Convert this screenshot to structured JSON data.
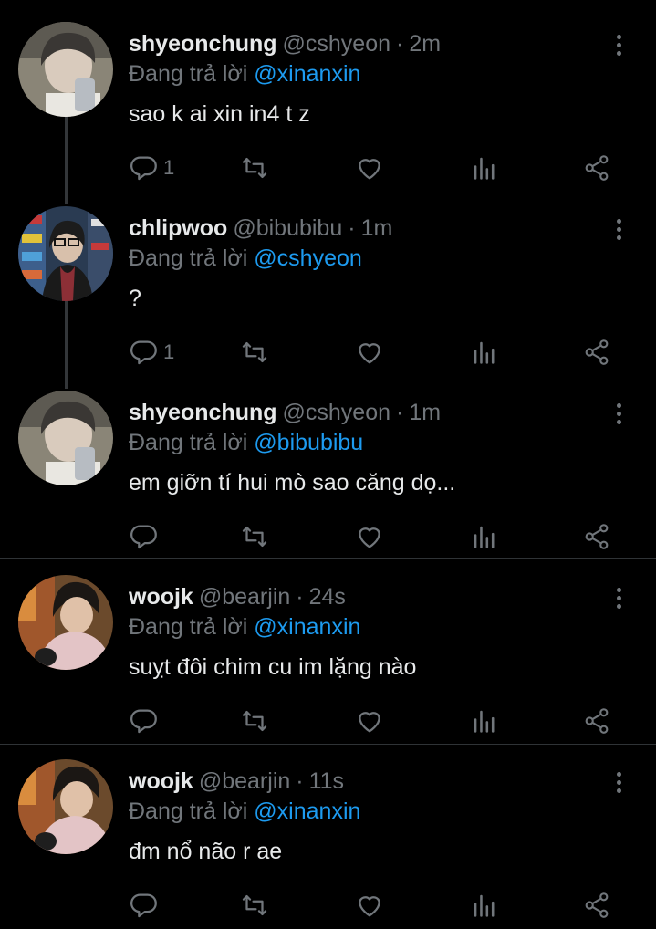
{
  "tweets": [
    {
      "name": "shyeonchung",
      "handle": "@cshyeon",
      "time": "2m",
      "replying_label": "Đang trả lời",
      "replying_to": "@xinanxin",
      "text": "sao k ai xin in4 t z",
      "reply_count": "1",
      "avatar": "avatar-shyeonchung"
    },
    {
      "name": "chlipwoo",
      "handle": "@bibubibu",
      "time": "1m",
      "replying_label": "Đang trả lời",
      "replying_to": "@cshyeon",
      "text": "?",
      "reply_count": "1",
      "avatar": "avatar-chlipwoo"
    },
    {
      "name": "shyeonchung",
      "handle": "@cshyeon",
      "time": "1m",
      "replying_label": "Đang trả lời",
      "replying_to": "@bibubibu",
      "text": "em giỡn tí hui mò sao căng dọ...",
      "reply_count": "",
      "avatar": "avatar-shyeonchung"
    },
    {
      "name": "woojk",
      "handle": "@bearjin",
      "time": "24s",
      "replying_label": "Đang trả lời",
      "replying_to": "@xinanxin",
      "text": "suỵt đôi chim cu im lặng nào",
      "reply_count": "",
      "avatar": "avatar-woojk"
    },
    {
      "name": "woojk",
      "handle": "@bearjin",
      "time": "11s",
      "replying_label": "Đang trả lời",
      "replying_to": "@xinanxin",
      "text": "đm nổ não r ae",
      "reply_count": "",
      "avatar": "avatar-woojk"
    }
  ],
  "separator": "·",
  "icons": {
    "reply": "reply-icon",
    "retweet": "retweet-icon",
    "like": "like-icon",
    "views": "views-icon",
    "share": "share-icon",
    "more": "more-vertical-icon"
  },
  "colors": {
    "background": "#000000",
    "text": "#e7e9ea",
    "muted": "#71767b",
    "mention": "#1d9bf0",
    "divider": "#2f3336",
    "thread_line": "#333639"
  }
}
